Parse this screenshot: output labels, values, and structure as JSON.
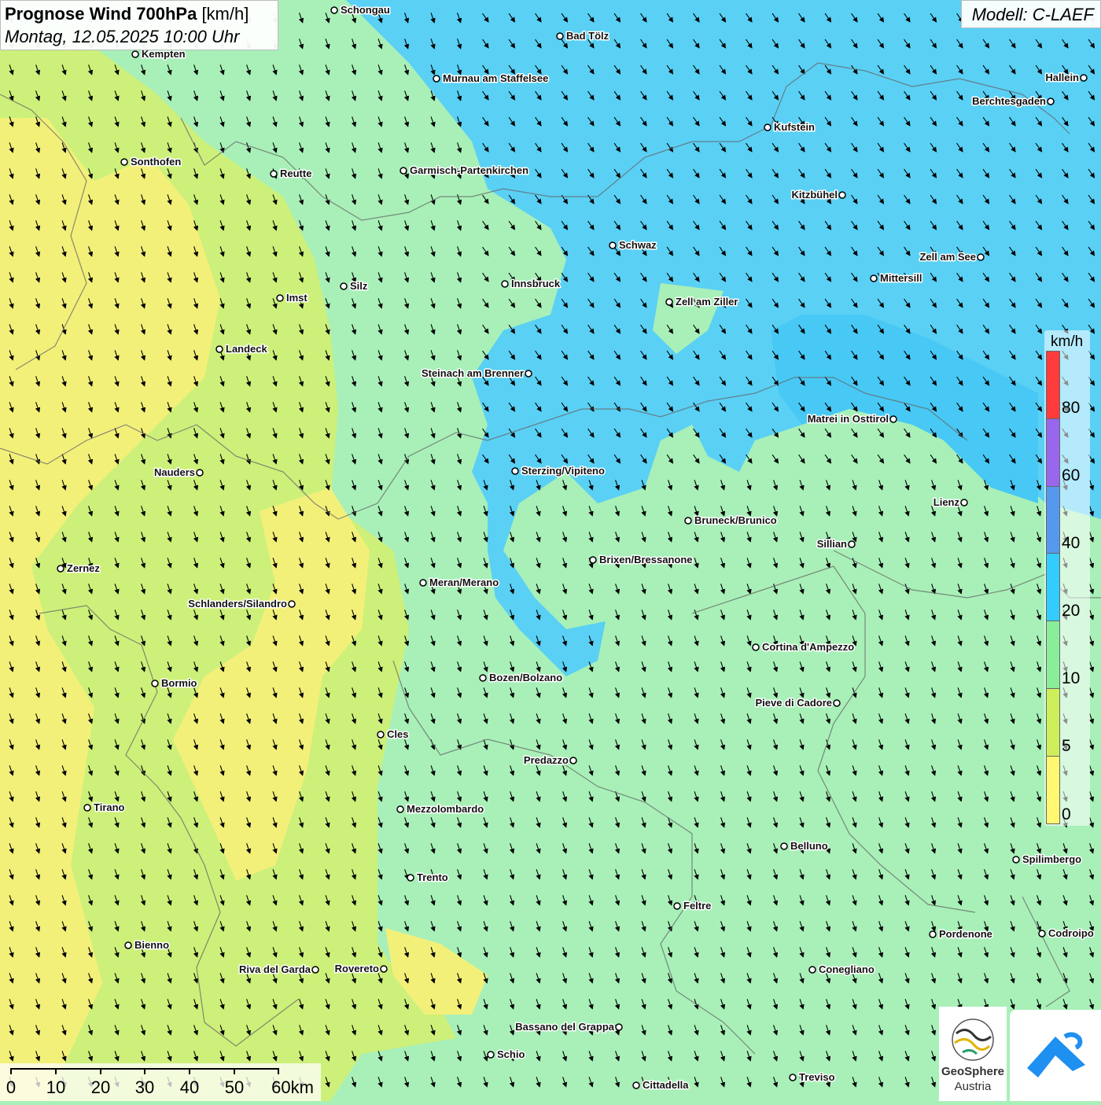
{
  "header": {
    "title_bold": "Prognose Wind 700hPa",
    "title_unit": "[km/h]",
    "datetime": "Montag, 12.05.2025 10:00 Uhr"
  },
  "model": {
    "label": "Modell: C-LAEF"
  },
  "legend": {
    "unit": "km/h",
    "labels": [
      "80",
      "60",
      "40",
      "20",
      "10",
      "5",
      "0"
    ],
    "colors": [
      "#ff3b3b",
      "#9966ee",
      "#5599ee",
      "#33ccff",
      "#88ee99",
      "#cdf05a",
      "#fff870"
    ]
  },
  "scalebar": {
    "labels": [
      "0",
      "10",
      "20",
      "30",
      "40",
      "50",
      "60km"
    ]
  },
  "logos": {
    "geosphere_line1": "GeoSphere",
    "geosphere_line2": "Austria"
  },
  "cities": [
    {
      "name": "Schongau"
    },
    {
      "name": "Bad Tölz"
    },
    {
      "name": "Kempten"
    },
    {
      "name": "Murnau am Staffelsee"
    },
    {
      "name": "Hallein"
    },
    {
      "name": "Berchtesgaden"
    },
    {
      "name": "Kufstein"
    },
    {
      "name": "Sonthofen"
    },
    {
      "name": "Reutte"
    },
    {
      "name": "Garmisch-Partenkirchen"
    },
    {
      "name": "Kitzbühel"
    },
    {
      "name": "Schwaz"
    },
    {
      "name": "Zell am See"
    },
    {
      "name": "Mittersill"
    },
    {
      "name": "Silz"
    },
    {
      "name": "Innsbruck"
    },
    {
      "name": "Imst"
    },
    {
      "name": "Zell am Ziller"
    },
    {
      "name": "Landeck"
    },
    {
      "name": "Steinach am Brenner"
    },
    {
      "name": "Matrei in Osttirol"
    },
    {
      "name": "Nauders"
    },
    {
      "name": "Sterzing/Vipiteno"
    },
    {
      "name": "Lienz"
    },
    {
      "name": "Bruneck/Brunico"
    },
    {
      "name": "Sillian"
    },
    {
      "name": "Brixen/Bressanone"
    },
    {
      "name": "Zernez"
    },
    {
      "name": "Meran/Merano"
    },
    {
      "name": "Schlanders/Silandro"
    },
    {
      "name": "Cortina d'Ampezzo"
    },
    {
      "name": "Bozen/Bolzano"
    },
    {
      "name": "Bormio"
    },
    {
      "name": "Pieve di Cadore"
    },
    {
      "name": "Cles"
    },
    {
      "name": "Predazzo"
    },
    {
      "name": "Tirano"
    },
    {
      "name": "Mezzolombardo"
    },
    {
      "name": "Belluno"
    },
    {
      "name": "Spilimbergo"
    },
    {
      "name": "Trento"
    },
    {
      "name": "Feltre"
    },
    {
      "name": "Pordenone"
    },
    {
      "name": "Codroipo"
    },
    {
      "name": "Bienno"
    },
    {
      "name": "Riva del Garda"
    },
    {
      "name": "Rovereto"
    },
    {
      "name": "Conegliano"
    },
    {
      "name": "Bassano del Grappa"
    },
    {
      "name": "Schio"
    },
    {
      "name": "Treviso"
    },
    {
      "name": "Cittadella"
    }
  ]
}
